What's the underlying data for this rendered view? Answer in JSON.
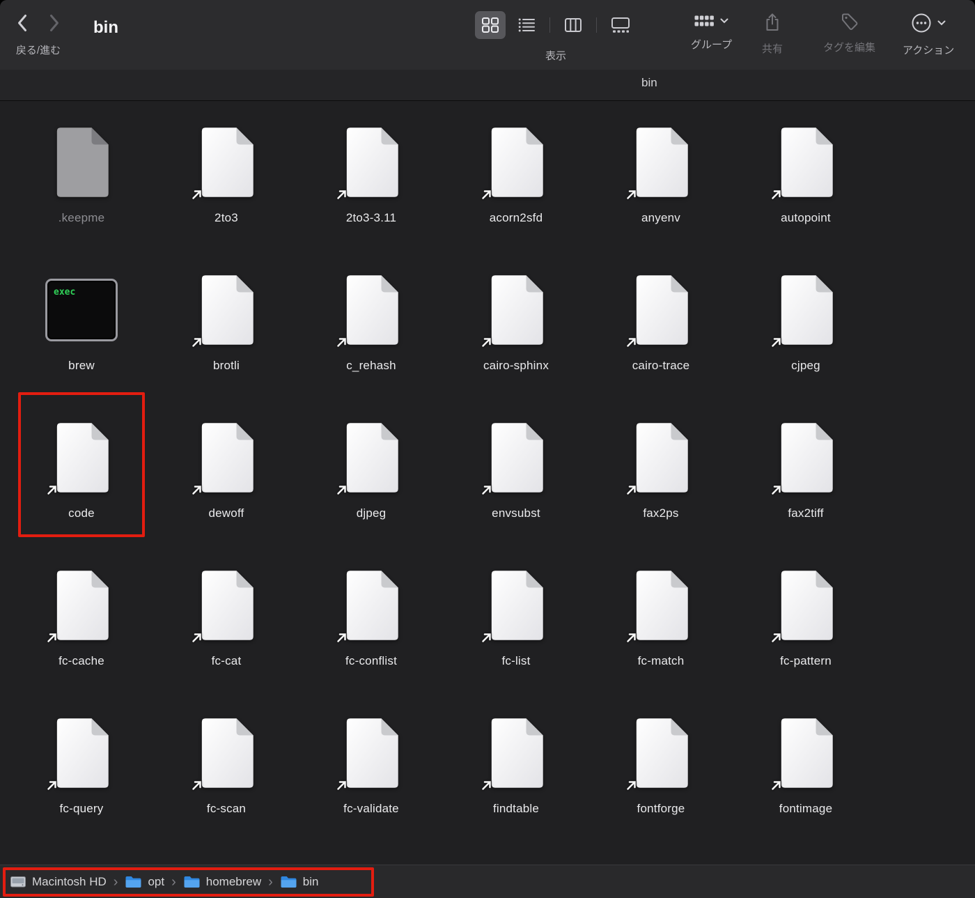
{
  "window": {
    "title": "bin",
    "subtitle": "bin"
  },
  "toolbar": {
    "back_forward_label": "戻る/進む",
    "view_label": "表示",
    "group_label": "グループ",
    "share_label": "共有",
    "tags_label": "タグを編集",
    "actions_label": "アクション"
  },
  "exec_badge_text": "exec",
  "files": [
    {
      "name": ".keepme",
      "kind": "hidden"
    },
    {
      "name": "2to3",
      "kind": "alias"
    },
    {
      "name": "2to3-3.11",
      "kind": "alias"
    },
    {
      "name": "acorn2sfd",
      "kind": "alias"
    },
    {
      "name": "anyenv",
      "kind": "alias"
    },
    {
      "name": "autopoint",
      "kind": "alias"
    },
    {
      "name": "brew",
      "kind": "exec"
    },
    {
      "name": "brotli",
      "kind": "alias"
    },
    {
      "name": "c_rehash",
      "kind": "alias"
    },
    {
      "name": "cairo-sphinx",
      "kind": "alias"
    },
    {
      "name": "cairo-trace",
      "kind": "alias"
    },
    {
      "name": "cjpeg",
      "kind": "alias"
    },
    {
      "name": "code",
      "kind": "alias",
      "annotated": true
    },
    {
      "name": "dewoff",
      "kind": "alias"
    },
    {
      "name": "djpeg",
      "kind": "alias"
    },
    {
      "name": "envsubst",
      "kind": "alias"
    },
    {
      "name": "fax2ps",
      "kind": "alias"
    },
    {
      "name": "fax2tiff",
      "kind": "alias"
    },
    {
      "name": "fc-cache",
      "kind": "alias"
    },
    {
      "name": "fc-cat",
      "kind": "alias"
    },
    {
      "name": "fc-conflist",
      "kind": "alias"
    },
    {
      "name": "fc-list",
      "kind": "alias"
    },
    {
      "name": "fc-match",
      "kind": "alias"
    },
    {
      "name": "fc-pattern",
      "kind": "alias"
    },
    {
      "name": "fc-query",
      "kind": "alias"
    },
    {
      "name": "fc-scan",
      "kind": "alias"
    },
    {
      "name": "fc-validate",
      "kind": "alias"
    },
    {
      "name": "findtable",
      "kind": "alias"
    },
    {
      "name": "fontforge",
      "kind": "alias"
    },
    {
      "name": "fontimage",
      "kind": "alias"
    }
  ],
  "path_bar": [
    {
      "label": "Macintosh HD",
      "icon": "drive"
    },
    {
      "label": "opt",
      "icon": "folder"
    },
    {
      "label": "homebrew",
      "icon": "folder"
    },
    {
      "label": "bin",
      "icon": "folder"
    }
  ],
  "pathbar_annotated": true,
  "colors": {
    "annotation": "#e21d10",
    "folder_blue": "#2f87e0",
    "exec_green": "#30d158"
  }
}
